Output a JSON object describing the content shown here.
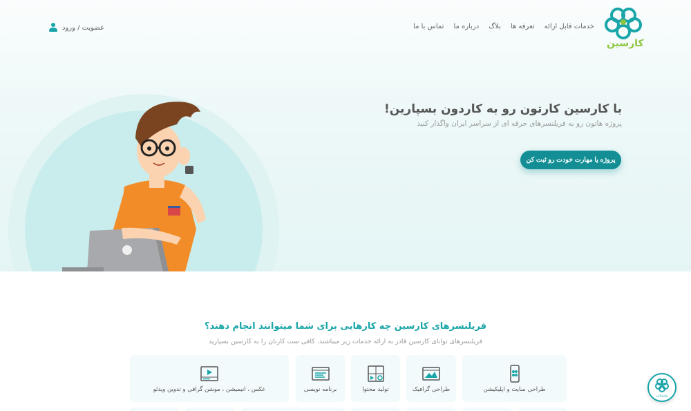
{
  "brand": {
    "name": "کارسین"
  },
  "nav": {
    "items": [
      {
        "label": "خدمات قابل ارائه"
      },
      {
        "label": "تعرفه ها"
      },
      {
        "label": "بلاگ"
      },
      {
        "label": "درباره ما"
      },
      {
        "label": "تماس با ما"
      }
    ],
    "auth_label": "عضویت / ورود"
  },
  "hero": {
    "title": "با کارسین کارتون رو به کاردون بسپارین!",
    "subtitle": "پروژه هاتون رو به فریلنسرهای حرفه ای از سراسر ایران واگذار کنید",
    "cta_label": "پروژه یا مهارت خودت رو ثبت کن"
  },
  "services": {
    "title": "فریلنسرهای کارسین چه کارهایی برای شما میتوانند انجام دهند؟",
    "subtitle": "فریلنسرهای توانای کارسین قادر به ارائه خدمات زیر میباشند. کافی ست کارتان را به کارسین بسپارید",
    "cards": [
      {
        "label": "طراحی سایت و اپلیکیشن",
        "icon": "mobile-app-icon"
      },
      {
        "label": "طراحی گرافیک",
        "icon": "graphic-design-icon"
      },
      {
        "label": "تولید محتوا",
        "icon": "content-icon"
      },
      {
        "label": "برنامه نویسی",
        "icon": "code-window-icon"
      },
      {
        "label": "عکس ، انیمیشن ، موشن گرافی و تدوین ویدئو",
        "icon": "video-player-icon"
      }
    ]
  },
  "chat_widget": {
    "label": "پشتیبانی"
  },
  "colors": {
    "accent": "#1aa5a8",
    "cta": "#138e94",
    "leaf": "#8cc63f"
  }
}
